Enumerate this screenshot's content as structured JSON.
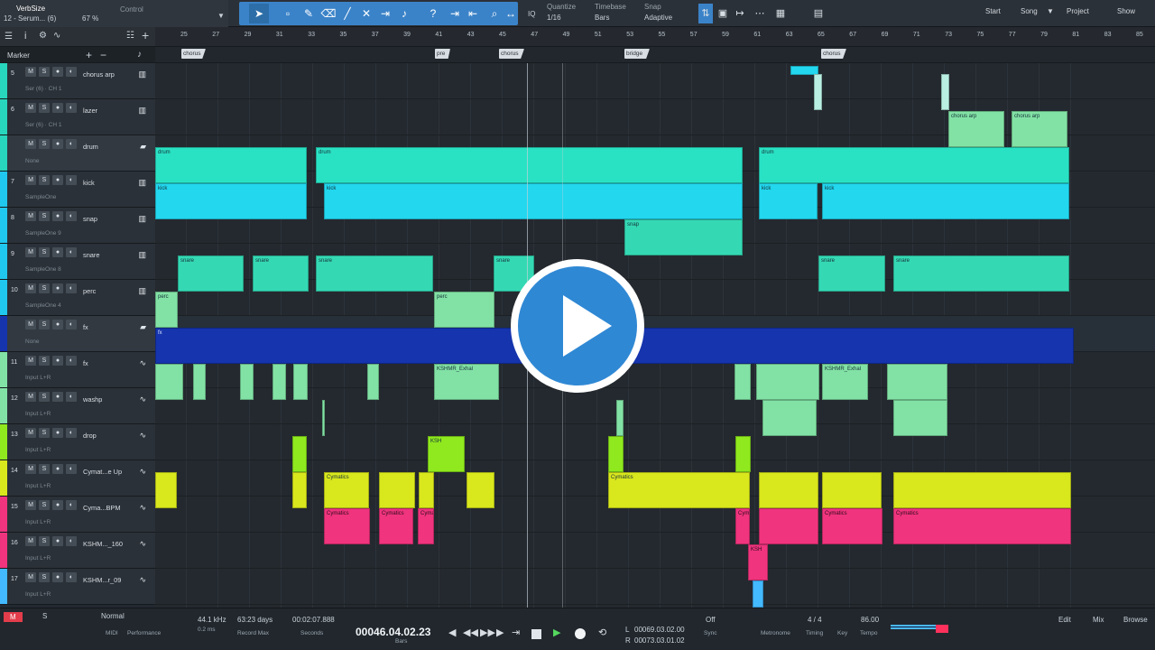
{
  "toolbar": {
    "plugin": "VerbSize",
    "track": "12 - Serum... (6)",
    "control": "Control",
    "percent": "67 %",
    "quantize_label": "Quantize",
    "quantize_value": "1/16",
    "timebase_label": "Timebase",
    "timebase_value": "Bars",
    "snap_label": "Snap",
    "snap_value": "Adaptive",
    "iq": "IQ",
    "nav": {
      "start": "Start",
      "song": "Song",
      "project": "Project",
      "show": "Show"
    }
  },
  "header": {
    "marker": "Marker"
  },
  "ruler": [
    25,
    27,
    29,
    31,
    33,
    35,
    37,
    39,
    41,
    43,
    45,
    47,
    49,
    51,
    53,
    55,
    57,
    59,
    61,
    63,
    65,
    67,
    69,
    71,
    73,
    75,
    77,
    79,
    81,
    83,
    85
  ],
  "markers": [
    "chorus",
    "pre",
    "chorus",
    "bridge",
    "chorus"
  ],
  "tracks": [
    {
      "num": "5",
      "name": "chorus arp",
      "sub": "Ser (6) · CH 1",
      "color": "#28d6bd",
      "icon": "piano-icon"
    },
    {
      "num": "6",
      "name": "lazer",
      "sub": "Ser (6) · CH 1",
      "color": "#28d6bd",
      "icon": "piano-icon"
    },
    {
      "num": "",
      "name": "drum",
      "sub": "None",
      "color": "#28d6bd",
      "icon": "folder-icon"
    },
    {
      "num": "7",
      "name": "kick",
      "sub": "SampleOne",
      "color": "#20c8ef",
      "icon": "piano-icon"
    },
    {
      "num": "8",
      "name": "snap",
      "sub": "SampleOne 9",
      "color": "#20c8ef",
      "icon": "piano-icon"
    },
    {
      "num": "9",
      "name": "snare",
      "sub": "SampleOne 8",
      "color": "#20c8ef",
      "icon": "piano-icon"
    },
    {
      "num": "10",
      "name": "perc",
      "sub": "SampleOne 4",
      "color": "#20c8ef",
      "icon": "piano-icon"
    },
    {
      "num": "",
      "name": "fx",
      "sub": "None",
      "color": "#1534ad",
      "icon": "folder-icon"
    },
    {
      "num": "11",
      "name": "fx",
      "sub": "Input L+R",
      "color": "#82e2a5",
      "icon": "wave-icon"
    },
    {
      "num": "12",
      "name": "washp",
      "sub": "Input L+R",
      "color": "#82e2a5",
      "icon": "wave-icon"
    },
    {
      "num": "13",
      "name": "drop",
      "sub": "Input L+R",
      "color": "#8fe91e",
      "icon": "wave-icon"
    },
    {
      "num": "14",
      "name": "Cymat...e Up",
      "sub": "Input L+R",
      "color": "#d9e71d",
      "icon": "wave-icon"
    },
    {
      "num": "15",
      "name": "Cyma...BPM",
      "sub": "Input L+R",
      "color": "#f0347e",
      "icon": "wave-icon"
    },
    {
      "num": "16",
      "name": "KSHM..._160",
      "sub": "Input L+R",
      "color": "#f0347e",
      "icon": "wave-icon"
    },
    {
      "num": "17",
      "name": "KSHM...r_09",
      "sub": "Input L+R",
      "color": "#43b9ff",
      "icon": "wave-icon"
    }
  ],
  "clips": {
    "chorus_arp": "chorus arp",
    "drum": "drum",
    "kick": "kick",
    "snap": "snap",
    "snare": "snare",
    "perc": "perc",
    "fx": "fx",
    "kshmr": "KSHMR_Exhal",
    "cymatics": "Cymatics",
    "cyma": "Cyma",
    "ksh": "KSH"
  },
  "bottom": {
    "m": "M",
    "s": "S",
    "normal": "Normal",
    "midi": "MIDI",
    "performance": "Performance",
    "sample_rate": "44.1 kHz",
    "latency": "0.2 ms",
    "record_days": "63:23 days",
    "record_max": "Record Max",
    "seconds_value": "00:02:07.888",
    "seconds": "Seconds",
    "bars_value": "00046.04.02.23",
    "bars": "Bars",
    "l": "L",
    "r": "R",
    "loop_l": "00069.03.02.00",
    "loop_r": "00073.03.01.02",
    "sync_off": "Off",
    "sync": "Sync",
    "metronome": "Metronome",
    "timing": "Timing",
    "time_sig": "4 / 4",
    "key": "Key",
    "tempo_value": "86.00",
    "tempo": "Tempo",
    "edit": "Edit",
    "mix": "Mix",
    "browse": "Browse"
  }
}
